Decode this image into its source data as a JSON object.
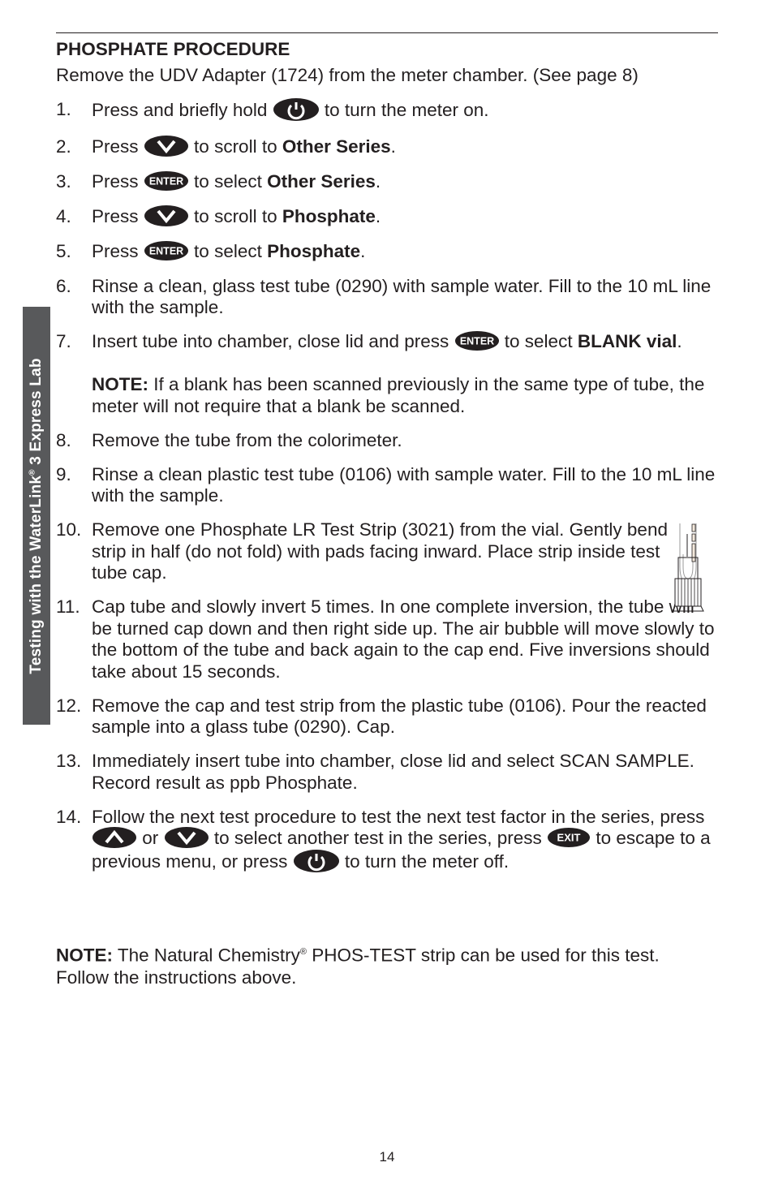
{
  "side_tab": {
    "text_before": "Testing with the WaterLink",
    "reg": "®",
    "text_after": " 3 Express Lab"
  },
  "heading": "PHOSPHATE PROCEDURE",
  "intro": "Remove the UDV Adapter (1724) from the meter chamber. (See page 8)",
  "icons": {
    "power": "power-button-icon",
    "down": "down-arrow-button-icon",
    "up": "up-arrow-button-icon",
    "enter": "enter-button-icon",
    "exit": "exit-button-icon",
    "enter_label": "ENTER",
    "exit_label": "EXIT"
  },
  "steps": [
    {
      "num": "1.",
      "a": "Press and briefly hold",
      "b": "to turn the meter on."
    },
    {
      "num": "2.",
      "a": "Press",
      "b": "to scroll to ",
      "bold": "Other Series",
      "c": "."
    },
    {
      "num": "3.",
      "a": "Press",
      "b": "to select ",
      "bold": "Other Series",
      "c": "."
    },
    {
      "num": "4.",
      "a": "Press",
      "b": "to scroll to ",
      "bold": "Phosphate",
      "c": "."
    },
    {
      "num": "5.",
      "a": "Press",
      "b": "to select ",
      "bold": "Phosphate",
      "c": "."
    },
    {
      "num": "6.",
      "text": "Rinse a clean, glass test tube (0290) with sample water. Fill to the 10 mL line with the sample."
    },
    {
      "num": "7.",
      "a": "Insert tube into chamber, close lid and press",
      "b": "to select ",
      "bold": "BLANK vial",
      "c": ".",
      "note_label": "NOTE:",
      "note": " If a blank has been scanned previously in the same type of tube, the meter will not require that a blank be scanned."
    },
    {
      "num": "8.",
      "text": "Remove the tube from the colorimeter."
    },
    {
      "num": "9.",
      "text": "Rinse a clean plastic test tube (0106) with sample water. Fill to the 10 mL line with the sample."
    },
    {
      "num": "10.",
      "text": "Remove one Phosphate LR Test Strip (3021) from the vial. Gently bend strip in half (do not fold) with pads facing inward. Place strip inside test tube cap."
    },
    {
      "num": "11.",
      "text": "Cap tube and slowly invert 5 times. In one complete inversion, the tube will be turned cap down and then right side up. The air bubble will move slowly to the bottom of the tube and back again to the cap end. Five inversions should take about 15 seconds."
    },
    {
      "num": "12.",
      "text": "Remove the cap and test strip from the plastic tube (0106). Pour the reacted sample into a glass tube (0290). Cap."
    },
    {
      "num": "13.",
      "text": "Immediately insert tube into chamber, close lid and select SCAN SAMPLE. Record result as ppb Phosphate."
    },
    {
      "num": "14.",
      "a": "Follow the next test procedure to test the next test factor in the series, press",
      "or": "or",
      "b": "to select another test in the series, press",
      "c": "to escape to a previous menu, or press",
      "d": "to turn the meter off."
    }
  ],
  "final_note": {
    "label": "NOTE:",
    "text_a": " The Natural Chemistry",
    "reg": "®",
    "text_b": " PHOS-TEST strip can be used for this test. Follow the instructions above."
  },
  "page_number": "14"
}
